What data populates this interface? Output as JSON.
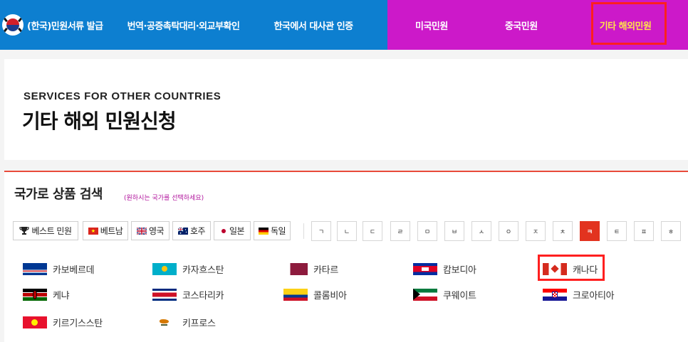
{
  "nav": {
    "items": [
      {
        "label": "(한국)민원서류 발급"
      },
      {
        "label": "번역·공증촉탁대리·외교부확인"
      },
      {
        "label": "한국에서 대사관 인증"
      },
      {
        "label": "미국민원"
      },
      {
        "label": "중국민원"
      },
      {
        "label": "기타 해외민원"
      }
    ],
    "colors": {
      "blue": "#0d7fd0",
      "pink": "#cc19c9",
      "active_text": "#ffe34a"
    }
  },
  "hero": {
    "subtitle": "SERVICES FOR OTHER COUNTRIES",
    "title": "기타 해외 민원신청"
  },
  "search": {
    "title": "국가로 상품 검색",
    "hint": "(원하시는 국가를 선택하세요)"
  },
  "quick_filters": [
    {
      "label": "베스트 민원",
      "icon": "trophy-icon"
    },
    {
      "label": "베트남",
      "icon": "vietnam-flag-icon"
    },
    {
      "label": "영국",
      "icon": "uk-flag-icon"
    },
    {
      "label": "호주",
      "icon": "australia-flag-icon"
    },
    {
      "label": "일본",
      "icon": "japan-flag-icon"
    },
    {
      "label": "독일",
      "icon": "germany-flag-icon"
    }
  ],
  "consonants": [
    "ㄱ",
    "ㄴ",
    "ㄷ",
    "ㄹ",
    "ㅁ",
    "ㅂ",
    "ㅅ",
    "ㅇ",
    "ㅈ",
    "ㅊ",
    "ㅋ",
    "ㅌ",
    "ㅍ",
    "ㅎ"
  ],
  "selected_consonant": "ㅋ",
  "countries": [
    {
      "name": "카보베르데",
      "icon": "cape-verde-flag-icon"
    },
    {
      "name": "카자흐스탄",
      "icon": "kazakhstan-flag-icon"
    },
    {
      "name": "카타르",
      "icon": "qatar-flag-icon"
    },
    {
      "name": "캄보디아",
      "icon": "cambodia-flag-icon"
    },
    {
      "name": "캐나다",
      "icon": "canada-flag-icon"
    },
    {
      "name": "케냐",
      "icon": "kenya-flag-icon"
    },
    {
      "name": "코스타리카",
      "icon": "costa-rica-flag-icon"
    },
    {
      "name": "콜롬비아",
      "icon": "colombia-flag-icon"
    },
    {
      "name": "쿠웨이트",
      "icon": "kuwait-flag-icon"
    },
    {
      "name": "크로아티아",
      "icon": "croatia-flag-icon"
    },
    {
      "name": "키르기스스탄",
      "icon": "kyrgyzstan-flag-icon"
    },
    {
      "name": "키프로스",
      "icon": "cyprus-flag-icon"
    }
  ],
  "accent_color": "#e2331f",
  "highlight_color": "#ff1f1f"
}
